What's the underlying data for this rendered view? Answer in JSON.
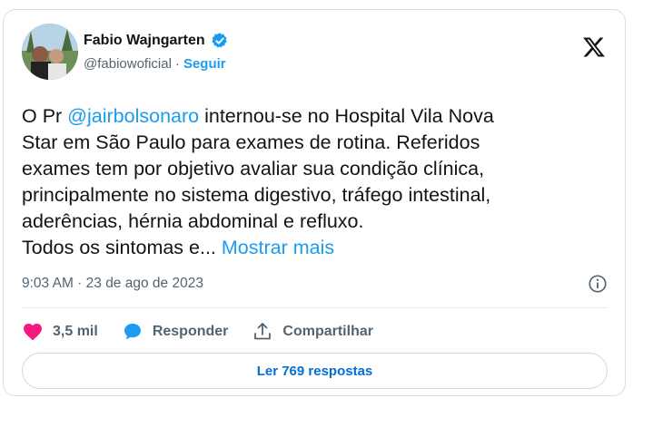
{
  "author": {
    "name": "Fabio Wajngarten",
    "handle": "@fabiowoficial",
    "separator": " · ",
    "follow_label": "Seguir"
  },
  "tweet": {
    "text_prefix": "O Pr ",
    "mention": "@jairbolsonaro",
    "text_main": " internou-se no Hospital Vila Nova\nStar em São Paulo para exames de rotina. Referidos\nexames tem por objetivo avaliar sua condição clínica,\nprincipalmente no sistema digestivo, tráfego intestinal,\naderências, hérnia abdominal e refluxo.\nTodos os sintomas e... ",
    "show_more": "Mostrar mais",
    "timestamp": "9:03 AM · 23 de ago de 2023"
  },
  "actions": {
    "likes": "3,5 mil",
    "reply_label": "Responder",
    "share_label": "Compartilhar"
  },
  "read_replies": "Ler 769 respostas",
  "colors": {
    "accent": "#1d9bf0",
    "like": "#f91880",
    "text": "#0f1419",
    "muted": "#536471"
  }
}
